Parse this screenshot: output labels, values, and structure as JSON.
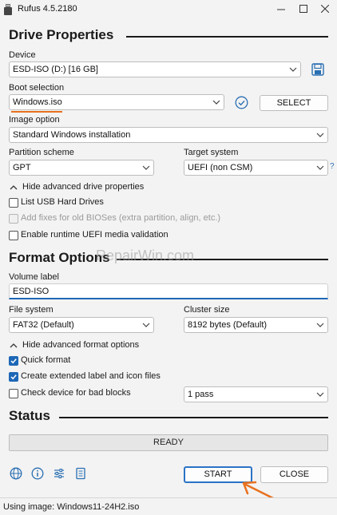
{
  "window": {
    "title": "Rufus 4.5.2180",
    "minimize_icon": "minimize-icon",
    "maximize_icon": "maximize-icon",
    "close_icon": "close-icon"
  },
  "drive_properties": {
    "title": "Drive Properties",
    "device_label": "Device",
    "device_value": "ESD-ISO (D:) [16 GB]",
    "boot_selection_label": "Boot selection",
    "boot_selection_value": "Windows.iso",
    "select_button": "SELECT",
    "image_option_label": "Image option",
    "image_option_value": "Standard Windows installation",
    "partition_scheme_label": "Partition scheme",
    "partition_scheme_value": "GPT",
    "target_system_label": "Target system",
    "target_system_value": "UEFI (non CSM)",
    "target_help": "?",
    "advanced_toggle": "Hide advanced drive properties",
    "list_usb": "List USB Hard Drives",
    "add_fixes": "Add fixes for old BIOSes (extra partition, align, etc.)",
    "enable_uefi": "Enable runtime UEFI media validation"
  },
  "format_options": {
    "title": "Format Options",
    "volume_label_label": "Volume label",
    "volume_label_value": "ESD-ISO",
    "file_system_label": "File system",
    "file_system_value": "FAT32 (Default)",
    "cluster_size_label": "Cluster size",
    "cluster_size_value": "8192 bytes (Default)",
    "advanced_toggle": "Hide advanced format options",
    "quick_format": "Quick format",
    "extended_label": "Create extended label and icon files",
    "bad_blocks": "Check device for bad blocks",
    "passes_value": "1 pass"
  },
  "status": {
    "title": "Status",
    "progress_text": "READY",
    "progress": 0
  },
  "actions": {
    "start": "START",
    "close": "CLOSE"
  },
  "statusbar": {
    "text": "Using image: Windows11-24H2.iso"
  },
  "watermark": "RepairWin.com",
  "checks": {
    "list_usb": false,
    "add_fixes": false,
    "enable_uefi": false,
    "quick_format": true,
    "extended_label": true,
    "bad_blocks": false
  },
  "colors": {
    "accent": "#1d67b6",
    "annotation_orange": "#e8711e",
    "background": "#f3f3f3"
  }
}
